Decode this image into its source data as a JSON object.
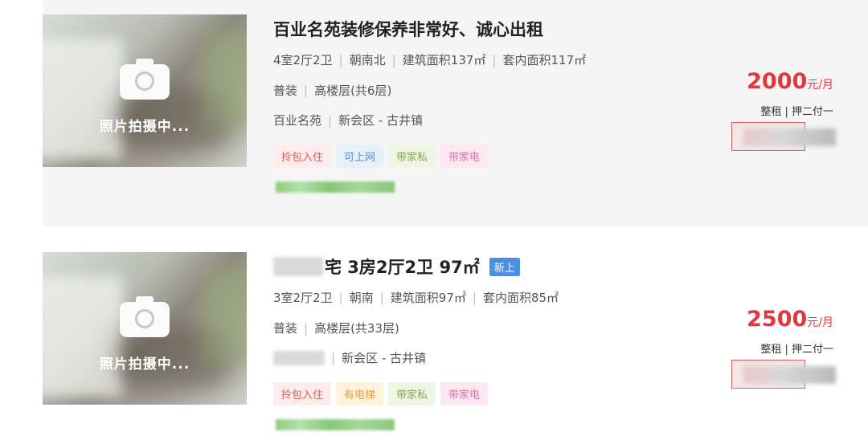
{
  "listings": [
    {
      "thumb_label": "照片拍摄中...",
      "title": "百业名苑装修保养非常好、诚心出租",
      "specs": [
        "4室2厅2卫",
        "朝南北",
        "建筑面积137㎡",
        "套内面积117㎡"
      ],
      "decor": [
        "普装",
        "高楼层(共6层)"
      ],
      "location": [
        "百业名苑",
        "新会区 - 古井镇"
      ],
      "tags": [
        "拎包入住",
        "可上网",
        "带家私",
        "带家电"
      ],
      "price": "2000",
      "price_unit": "元/月",
      "pay_terms": "整租 | 押二付一"
    },
    {
      "thumb_label": "照片拍摄中...",
      "title": "宅 3房2厅2卫 97㎡",
      "badge": "新上",
      "specs": [
        "3室2厅2卫",
        "朝南",
        "建筑面积97㎡",
        "套内面积85㎡"
      ],
      "decor": [
        "普装",
        "高楼层(共33层)"
      ],
      "location": [
        "新会区 - 古井镇"
      ],
      "tags": [
        "拎包入住",
        "有电梯",
        "带家私",
        "带家电"
      ],
      "price": "2500",
      "price_unit": "元/月",
      "pay_terms": "整租 | 押二付一"
    }
  ],
  "colors": {
    "price": "#e0383e",
    "badge_new": "#4a90e2",
    "first_card_bg": "#f5f5f5"
  },
  "icons": [
    "camera-icon"
  ]
}
